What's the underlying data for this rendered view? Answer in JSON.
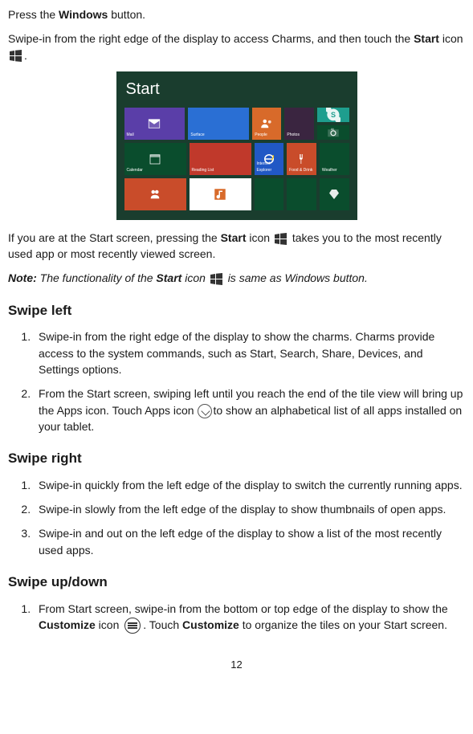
{
  "intro": {
    "p1_a": "Press the ",
    "p1_b": "Windows",
    "p1_c": " button.",
    "p2_a": "Swipe-in from the right edge of the display to access Charms, and then touch the ",
    "p2_b": "Start",
    "p2_c": " icon "
  },
  "start_screen": {
    "title": "Start",
    "tiles": {
      "mail": "Mail",
      "surface": "Surface",
      "people": "People",
      "photos": "Photos",
      "calendar": "Calendar",
      "readinglist": "Reading List",
      "ie": "Internet Explorer",
      "food": "Food & Drink",
      "weather": "Weather",
      "skype": "",
      "camera": "",
      "games": "",
      "music": "",
      "video": "",
      "apps": ""
    }
  },
  "after_image": {
    "p3_a": "If you are at the Start screen, pressing the ",
    "p3_b": "Start",
    "p3_c": " icon ",
    "p3_d": " takes you to the most recently used app or most recently viewed screen.",
    "note_l": "Note:",
    "note_a": " The functionality of the ",
    "note_b": "Start",
    "note_c": " icon ",
    "note_d": " is same as Windows button."
  },
  "swipe_left": {
    "heading": "Swipe left",
    "i1": "Swipe-in from the right edge of the display to show the charms. Charms provide access to the system commands, such as Start, Search, Share, Devices, and Settings options.",
    "i2_a": "From the Start screen, swiping left until you reach the end of the tile view will bring up the Apps icon. Touch Apps icon ",
    "i2_b": "to show an alphabetical list of all apps installed on your tablet."
  },
  "swipe_right": {
    "heading": "Swipe right",
    "i1": "Swipe-in quickly from the left edge of the display to switch the currently running apps.",
    "i2": "Swipe-in slowly from the left edge of the display to show thumbnails of open apps.",
    "i3": "Swipe-in and out on the left edge of the display to show a list of the most recently used apps."
  },
  "swipe_ud": {
    "heading": "Swipe up/down",
    "i1_a": "From Start screen, swipe-in from the bottom or top edge of the display to show the ",
    "i1_b": "Customize",
    "i1_c": " icon ",
    "i1_d": ". Touch ",
    "i1_e": "Customize",
    "i1_f": " to organize the tiles on your Start screen."
  },
  "page_number": "12"
}
